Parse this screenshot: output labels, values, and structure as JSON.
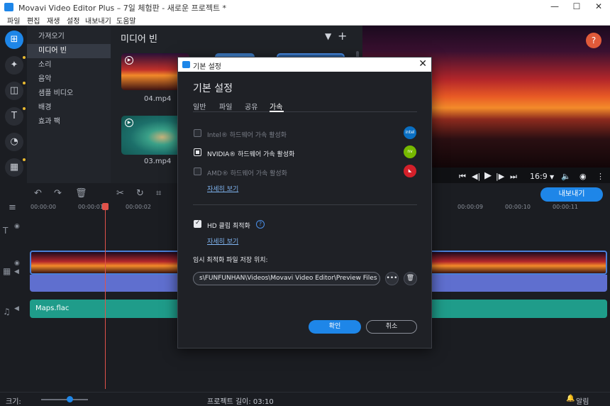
{
  "window": {
    "title": "Movavi Video Editor Plus – 7일 체험판 - 새로운 프로젝트 *"
  },
  "menu": [
    "파일",
    "편집",
    "재생",
    "설정",
    "내보내기",
    "도움말"
  ],
  "sidebar": {
    "items": [
      {
        "label": "가져오기"
      },
      {
        "label": "미디어 빈"
      },
      {
        "label": "소리"
      },
      {
        "label": "음악"
      },
      {
        "label": "샘플 비디오"
      },
      {
        "label": "배경"
      },
      {
        "label": "효과 팩"
      }
    ]
  },
  "mediabin": {
    "title": "미디어 빈",
    "files": [
      "04.mp4",
      "03.mp4"
    ]
  },
  "player": {
    "ratio": "16:9"
  },
  "timeline": {
    "export_label": "내보내기",
    "ruler": [
      "00:00:00",
      "00:00:01",
      "00:00:02",
      "00:00:09",
      "00:00:10",
      "00:00:11"
    ],
    "music_clip": "Maps.flac"
  },
  "statusbar": {
    "zoom_label": "크기:",
    "project_length": "프로젝트 길이: 03:10",
    "notifications": "알림"
  },
  "dialog": {
    "title": "기본 설정",
    "heading": "기본 설정",
    "tabs": [
      "일반",
      "파일",
      "공유",
      "가속"
    ],
    "active_tab": "가속",
    "options": [
      {
        "label": "Intel® 하드웨어 가속 활성화",
        "checked": false,
        "enabled": false,
        "vendor": "intel"
      },
      {
        "label": "NVIDIA® 하드웨어 가속 활성화",
        "checked": true,
        "enabled": true,
        "vendor": "nvidia"
      },
      {
        "label": "AMD® 하드웨어 가속 활성화",
        "checked": false,
        "enabled": false,
        "vendor": "amd"
      }
    ],
    "details_link_1": "자세히 보기",
    "hd_option": {
      "label": "HD 클립 최적화",
      "checked": true
    },
    "details_link_2": "자세히 보기",
    "path_label": "임시 최적화 파일 저장 위치:",
    "path_value": "s\\FUNFUNHAN\\Videos\\Movavi Video Editor\\Preview Files",
    "ok_label": "확인",
    "cancel_label": "취소"
  },
  "colors": {
    "accent": "#1e86e8",
    "music_track": "#1f9c8a",
    "audio_track": "#5f6fcf",
    "playhead": "#e0524a"
  }
}
